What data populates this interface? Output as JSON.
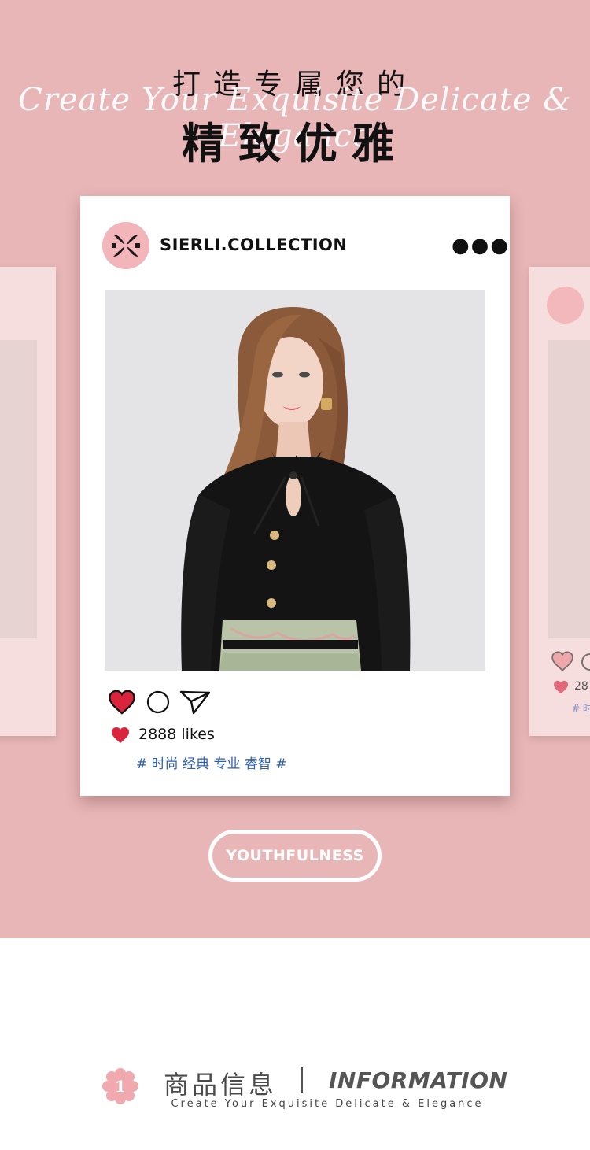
{
  "header": {
    "title_line1": "打造专属您的",
    "script_text": "Create Your Exquisite Delicate & Elegance",
    "title_line2": "精致优雅"
  },
  "post": {
    "account_name": "SIERLI.COLLECTION",
    "likes_text": "2888 likes",
    "tags": "# 时尚 经典 专业 睿智 #"
  },
  "ghost_card_right": {
    "likes_text": "28",
    "tags": "# 时"
  },
  "cta": {
    "label": "YOUTHFULNESS"
  },
  "info": {
    "badge_number": "1",
    "title_cn": "商品信息",
    "title_en": "INFORMATION",
    "subtitle": "Create Your Exquisite Delicate & Elegance"
  },
  "colors": {
    "background_pink": "#e8b6b7",
    "logo_pink": "#f2b5b9",
    "like_red": "#d9243c",
    "tag_blue": "#2f5fb3"
  },
  "icons": {
    "more": "more-options-icon",
    "like": "heart-icon",
    "comment": "comment-icon",
    "share": "send-icon",
    "logo": "brand-logo-icon",
    "badge": "flower-badge-icon"
  }
}
